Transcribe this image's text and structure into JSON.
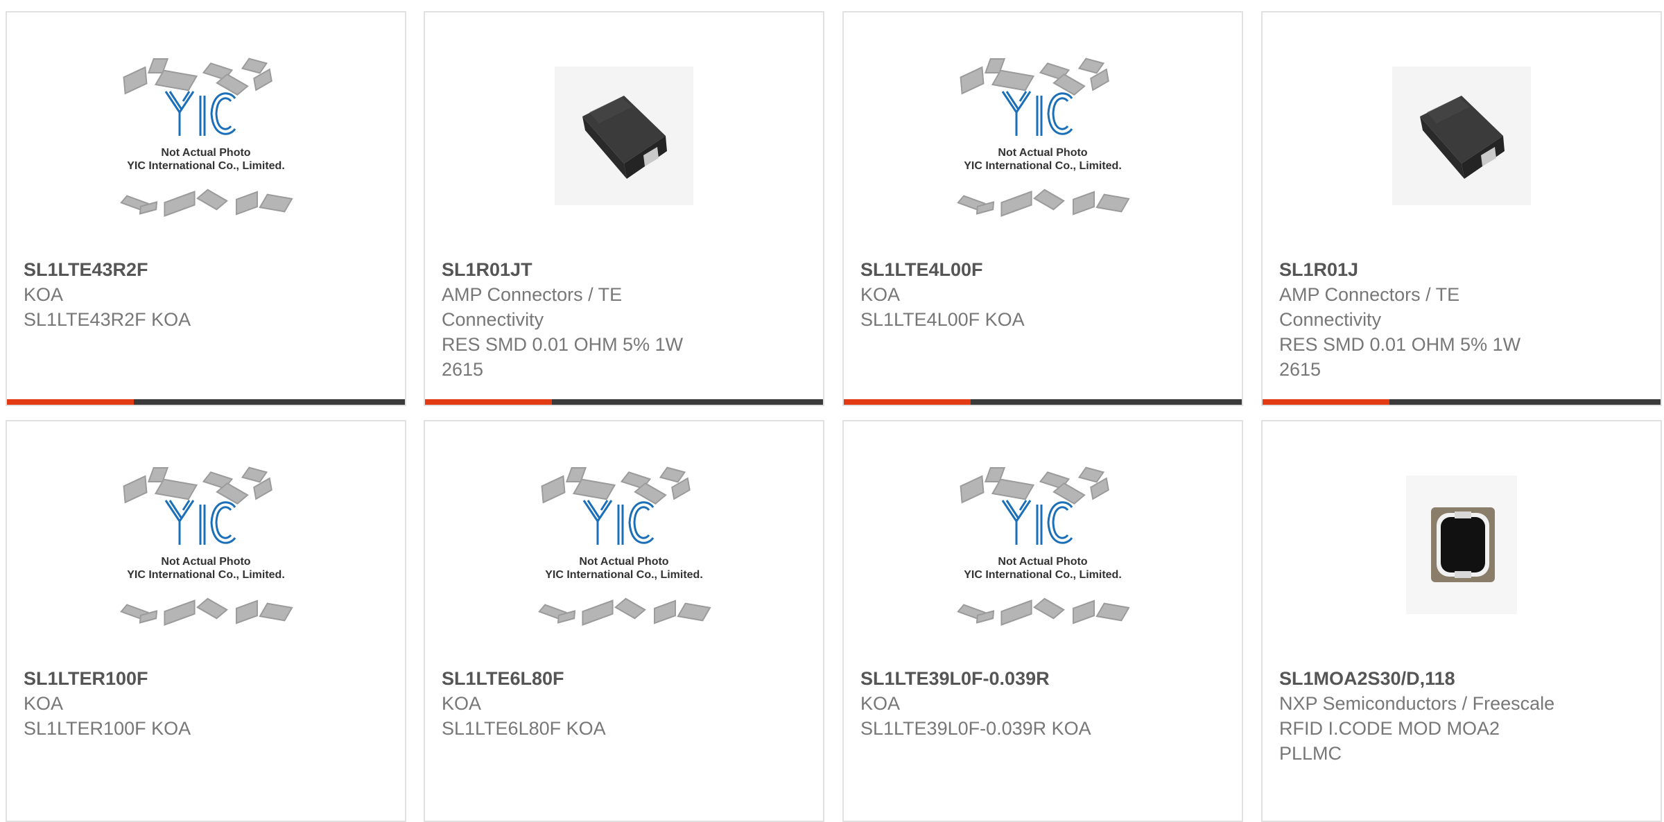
{
  "colors": {
    "accent": "#e23b13",
    "bar": "#3a3a3a",
    "border": "#e1e1e1",
    "text": "#777777",
    "title": "#555555",
    "logo": "#1a6fb8"
  },
  "products": [
    {
      "part": "SL1LTE43R2F",
      "lines": [
        "KOA",
        "SL1LTE43R2F KOA"
      ],
      "image": "not-actual-photo-placeholder",
      "placeholder_text_1": "Not Actual Photo",
      "placeholder_text_2": "YIC International Co., Limited.",
      "logo_text": "YIC",
      "has_bar": true
    },
    {
      "part": "SL1R01JT",
      "lines": [
        "AMP Connectors / TE",
        "Connectivity",
        "RES SMD 0.01 OHM 5% 1W",
        "2615"
      ],
      "image": "smd-resistor-photo",
      "has_bar": true
    },
    {
      "part": "SL1LTE4L00F",
      "lines": [
        "KOA",
        "SL1LTE4L00F KOA"
      ],
      "image": "not-actual-photo-placeholder",
      "placeholder_text_1": "Not Actual Photo",
      "placeholder_text_2": "YIC International Co., Limited.",
      "logo_text": "YIC",
      "has_bar": true
    },
    {
      "part": "SL1R01J",
      "lines": [
        "AMP Connectors / TE",
        "Connectivity",
        "RES SMD 0.01 OHM 5% 1W",
        "2615"
      ],
      "image": "smd-resistor-photo",
      "has_bar": true
    },
    {
      "part": "SL1LTER100F",
      "lines": [
        "KOA",
        "SL1LTER100F KOA"
      ],
      "image": "not-actual-photo-placeholder",
      "placeholder_text_1": "Not Actual Photo",
      "placeholder_text_2": "YIC International Co., Limited.",
      "logo_text": "YIC",
      "has_bar": false
    },
    {
      "part": "SL1LTE6L80F",
      "lines": [
        "KOA",
        "SL1LTE6L80F KOA"
      ],
      "image": "not-actual-photo-placeholder",
      "placeholder_text_1": "Not Actual Photo",
      "placeholder_text_2": "YIC International Co., Limited.",
      "logo_text": "YIC",
      "has_bar": false
    },
    {
      "part": "SL1LTE39L0F-0.039R",
      "lines": [
        "KOA",
        "SL1LTE39L0F-0.039R KOA"
      ],
      "image": "not-actual-photo-placeholder",
      "placeholder_text_1": "Not Actual Photo",
      "placeholder_text_2": "YIC International Co., Limited.",
      "logo_text": "YIC",
      "has_bar": false
    },
    {
      "part": "SL1MOA2S30/D,118",
      "lines": [
        "NXP Semiconductors / Freescale",
        "RFID I.CODE MOD MOA2",
        "PLLMC"
      ],
      "image": "rfid-module-photo",
      "has_bar": false
    }
  ]
}
